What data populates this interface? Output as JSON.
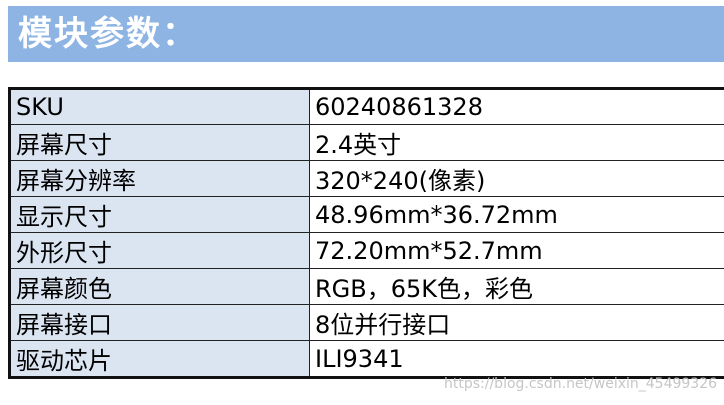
{
  "header": {
    "title": "模块参数："
  },
  "spec_table": {
    "rows": [
      {
        "label": "SKU",
        "value": "60240861328"
      },
      {
        "label": "屏幕尺寸",
        "value": "2.4英寸"
      },
      {
        "label": "屏幕分辨率",
        "value": "320*240(像素)"
      },
      {
        "label": "显示尺寸",
        "value": "48.96mm*36.72mm"
      },
      {
        "label": "外形尺寸",
        "value": "72.20mm*52.7mm"
      },
      {
        "label": "屏幕颜色",
        "value": "RGB，65K色，彩色"
      },
      {
        "label": "屏幕接口",
        "value": "8位并行接口"
      },
      {
        "label": "驱动芯片",
        "value": "ILI9341"
      }
    ]
  },
  "watermark": {
    "text": "https://blog.csdn.net/weixin_45499326"
  },
  "colors": {
    "header_bg": "#8eb4e3",
    "label_bg": "#dbe5f1",
    "value_bg": "#ffffff",
    "border": "#222222"
  }
}
